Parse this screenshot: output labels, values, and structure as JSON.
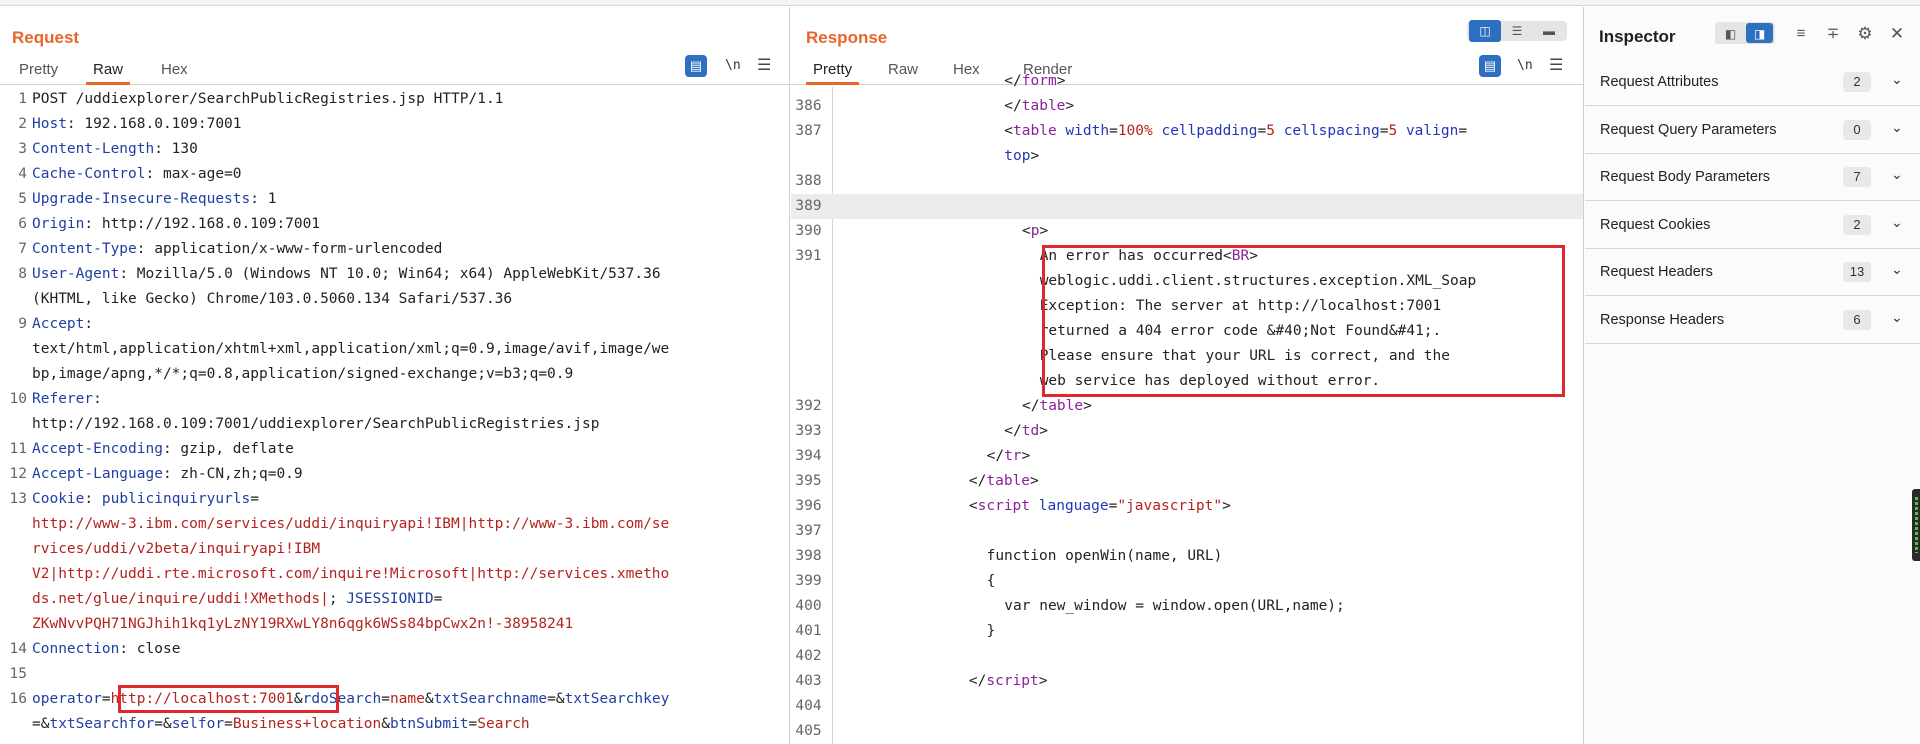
{
  "request": {
    "title": "Request",
    "tabs": [
      "Pretty",
      "Raw",
      "Hex"
    ],
    "active_tab": "Raw",
    "ln_toggle": "\\n",
    "lines": [
      {
        "n": "1",
        "rows": [
          [
            [
              "pl",
              "POST /uddiexplorer/SearchPublicRegistries.jsp HTTP/1.1"
            ]
          ]
        ]
      },
      {
        "n": "2",
        "rows": [
          [
            [
              "k",
              "Host"
            ],
            [
              "pl",
              ": 192.168.0.109:7001"
            ]
          ]
        ]
      },
      {
        "n": "3",
        "rows": [
          [
            [
              "k",
              "Content-Length"
            ],
            [
              "pl",
              ": 130"
            ]
          ]
        ]
      },
      {
        "n": "4",
        "rows": [
          [
            [
              "k",
              "Cache-Control"
            ],
            [
              "pl",
              ": max-age=0"
            ]
          ]
        ]
      },
      {
        "n": "5",
        "rows": [
          [
            [
              "k",
              "Upgrade-Insecure-Requests"
            ],
            [
              "pl",
              ": 1"
            ]
          ]
        ]
      },
      {
        "n": "6",
        "rows": [
          [
            [
              "k",
              "Origin"
            ],
            [
              "pl",
              ": http://192.168.0.109:7001"
            ]
          ]
        ]
      },
      {
        "n": "7",
        "rows": [
          [
            [
              "k",
              "Content-Type"
            ],
            [
              "pl",
              ": application/x-www-form-urlencoded"
            ]
          ]
        ]
      },
      {
        "n": "8",
        "rows": [
          [
            [
              "k",
              "User-Agent"
            ],
            [
              "pl",
              ": Mozilla/5.0 (Windows NT 10.0; Win64; x64) AppleWebKit/537.36"
            ]
          ],
          [
            [
              "pl",
              "(KHTML, like Gecko) Chrome/103.0.5060.134 Safari/537.36"
            ]
          ]
        ]
      },
      {
        "n": "9",
        "rows": [
          [
            [
              "k",
              "Accept"
            ],
            [
              "pl",
              ":"
            ]
          ],
          [
            [
              "pl",
              "text/html,application/xhtml+xml,application/xml;q=0.9,image/avif,image/we"
            ]
          ],
          [
            [
              "pl",
              "bp,image/apng,*/*;q=0.8,application/signed-exchange;v=b3;q=0.9"
            ]
          ]
        ]
      },
      {
        "n": "10",
        "rows": [
          [
            [
              "k",
              "Referer"
            ],
            [
              "pl",
              ":"
            ]
          ],
          [
            [
              "pl",
              "http://192.168.0.109:7001/uddiexplorer/SearchPublicRegistries.jsp"
            ]
          ]
        ]
      },
      {
        "n": "11",
        "rows": [
          [
            [
              "k",
              "Accept-Encoding"
            ],
            [
              "pl",
              ": gzip, deflate"
            ]
          ]
        ]
      },
      {
        "n": "12",
        "rows": [
          [
            [
              "k",
              "Accept-Language"
            ],
            [
              "pl",
              ": zh-CN,zh;q=0.9"
            ]
          ]
        ]
      },
      {
        "n": "13",
        "rows": [
          [
            [
              "k",
              "Cookie"
            ],
            [
              "pl",
              ": "
            ],
            [
              "k",
              "publicinquiryurls"
            ],
            [
              "pl",
              "="
            ]
          ],
          [
            [
              "v",
              "http://www-3.ibm.com/services/uddi/inquiryapi!IBM|http://www-3.ibm.com/se"
            ]
          ],
          [
            [
              "v",
              "rvices/uddi/v2beta/inquiryapi!IBM"
            ]
          ],
          [
            [
              "v",
              "V2|http://uddi.rte.microsoft.com/inquire!Microsoft|http://services.xmetho"
            ]
          ],
          [
            [
              "v",
              "ds.net/glue/inquire/uddi!XMethods|"
            ],
            [
              "pl",
              "; "
            ],
            [
              "k",
              "JSESSIONID"
            ],
            [
              "pl",
              "="
            ]
          ],
          [
            [
              "v",
              "ZKwNvvPQH71NGJhih1kq1yLzNY19RXwLY8n6qgk6WSs84bpCwx2n!-38958241"
            ]
          ]
        ]
      },
      {
        "n": "14",
        "rows": [
          [
            [
              "k",
              "Connection"
            ],
            [
              "pl",
              ": close"
            ]
          ]
        ]
      },
      {
        "n": "15",
        "rows": [
          [
            [
              "pl",
              ""
            ]
          ]
        ]
      },
      {
        "n": "16",
        "rows": [
          [
            [
              "k",
              "operator"
            ],
            [
              "pl",
              "="
            ],
            [
              "v",
              "http://localhost:7001"
            ],
            [
              "pl",
              "&"
            ],
            [
              "k",
              "rdoSearch"
            ],
            [
              "pl",
              "="
            ],
            [
              "v",
              "name"
            ],
            [
              "pl",
              "&"
            ],
            [
              "k",
              "txtSearchname"
            ],
            [
              "pl",
              "=&"
            ],
            [
              "k",
              "txtSearchkey"
            ]
          ],
          [
            [
              "pl",
              "=&"
            ],
            [
              "k",
              "txtSearchfor"
            ],
            [
              "pl",
              "=&"
            ],
            [
              "k",
              "selfor"
            ],
            [
              "pl",
              "="
            ],
            [
              "v",
              "Business+location"
            ],
            [
              "pl",
              "&"
            ],
            [
              "k",
              "btnSubmit"
            ],
            [
              "pl",
              "="
            ],
            [
              "v",
              "Search"
            ]
          ]
        ]
      }
    ]
  },
  "response": {
    "title": "Response",
    "tabs": [
      "Pretty",
      "Raw",
      "Hex",
      "Render"
    ],
    "active_tab": "Pretty",
    "ln_toggle": "\\n",
    "lines": [
      {
        "n": "",
        "indent": 18,
        "rows": [
          [
            [
              "pl",
              "</"
            ],
            [
              "t",
              "form"
            ],
            [
              "pl",
              ">"
            ]
          ]
        ]
      },
      {
        "n": "386",
        "indent": 18,
        "rows": [
          [
            [
              "pl",
              "</"
            ],
            [
              "t",
              "table"
            ],
            [
              "pl",
              ">"
            ]
          ]
        ]
      },
      {
        "n": "387",
        "indent": 18,
        "rows": [
          [
            [
              "pl",
              "<"
            ],
            [
              "t",
              "table"
            ],
            [
              "pl",
              " "
            ],
            [
              "a",
              "width"
            ],
            [
              "pl",
              "="
            ],
            [
              "v",
              "100%"
            ],
            [
              "pl",
              " "
            ],
            [
              "a",
              "cellpadding"
            ],
            [
              "pl",
              "="
            ],
            [
              "v",
              "5"
            ],
            [
              "pl",
              " "
            ],
            [
              "a",
              "cellspacing"
            ],
            [
              "pl",
              "="
            ],
            [
              "v",
              "5"
            ],
            [
              "pl",
              " "
            ],
            [
              "a",
              "valign"
            ],
            [
              "pl",
              "="
            ]
          ],
          [
            [
              "a",
              "top"
            ],
            [
              "pl",
              ">"
            ]
          ]
        ]
      },
      {
        "n": "388",
        "indent": 0,
        "rows": [
          [
            [
              "pl",
              ""
            ]
          ]
        ]
      },
      {
        "n": "389",
        "indent": 0,
        "hl": true,
        "rows": [
          [
            [
              "pl",
              ""
            ]
          ]
        ]
      },
      {
        "n": "390",
        "indent": 20,
        "rows": [
          [
            [
              "pl",
              "<"
            ],
            [
              "t",
              "p"
            ],
            [
              "pl",
              ">"
            ]
          ]
        ]
      },
      {
        "n": "391",
        "indent": 22,
        "rows": [
          [
            [
              "pl",
              "An error has occurred<"
            ],
            [
              "t",
              "BR"
            ],
            [
              "pl",
              ">"
            ]
          ],
          [
            [
              "pl",
              "weblogic.uddi.client.structures.exception.XML_Soap"
            ]
          ],
          [
            [
              "pl",
              "Exception: The server at http://localhost:7001"
            ]
          ],
          [
            [
              "pl",
              "returned a 404 error code &#40;Not Found&#41;."
            ]
          ],
          [
            [
              "pl",
              "Please ensure that your URL is correct, and the"
            ]
          ],
          [
            [
              "pl",
              "web service has deployed without error."
            ]
          ]
        ]
      },
      {
        "n": "392",
        "indent": 20,
        "rows": [
          [
            [
              "pl",
              "</"
            ],
            [
              "t",
              "table"
            ],
            [
              "pl",
              ">"
            ]
          ]
        ]
      },
      {
        "n": "393",
        "indent": 18,
        "rows": [
          [
            [
              "pl",
              "</"
            ],
            [
              "t",
              "td"
            ],
            [
              "pl",
              ">"
            ]
          ]
        ]
      },
      {
        "n": "394",
        "indent": 16,
        "rows": [
          [
            [
              "pl",
              "</"
            ],
            [
              "t",
              "tr"
            ],
            [
              "pl",
              ">"
            ]
          ]
        ]
      },
      {
        "n": "395",
        "indent": 14,
        "rows": [
          [
            [
              "pl",
              "</"
            ],
            [
              "t",
              "table"
            ],
            [
              "pl",
              ">"
            ]
          ]
        ]
      },
      {
        "n": "396",
        "indent": 14,
        "rows": [
          [
            [
              "pl",
              "<"
            ],
            [
              "t",
              "script"
            ],
            [
              "pl",
              " "
            ],
            [
              "a",
              "language"
            ],
            [
              "pl",
              "="
            ],
            [
              "v",
              "\"javascript\""
            ],
            [
              "pl",
              ">"
            ]
          ]
        ]
      },
      {
        "n": "397",
        "indent": 0,
        "rows": [
          [
            [
              "pl",
              ""
            ]
          ]
        ]
      },
      {
        "n": "398",
        "indent": 16,
        "rows": [
          [
            [
              "pl",
              "function openWin(name, URL)"
            ]
          ]
        ]
      },
      {
        "n": "399",
        "indent": 16,
        "rows": [
          [
            [
              "pl",
              "{"
            ]
          ]
        ]
      },
      {
        "n": "400",
        "indent": 18,
        "rows": [
          [
            [
              "pl",
              "var new_window = window.open(URL,name);"
            ]
          ]
        ]
      },
      {
        "n": "401",
        "indent": 16,
        "rows": [
          [
            [
              "pl",
              "}"
            ]
          ]
        ]
      },
      {
        "n": "402",
        "indent": 0,
        "rows": [
          [
            [
              "pl",
              ""
            ]
          ]
        ]
      },
      {
        "n": "403",
        "indent": 14,
        "rows": [
          [
            [
              "pl",
              "</"
            ],
            [
              "t",
              "script"
            ],
            [
              "pl",
              ">"
            ]
          ]
        ]
      },
      {
        "n": "404",
        "indent": 0,
        "rows": [
          [
            [
              "pl",
              ""
            ]
          ]
        ]
      },
      {
        "n": "405",
        "indent": 0,
        "rows": [
          [
            [
              "pl",
              ""
            ]
          ]
        ]
      }
    ]
  },
  "inspector": {
    "title": "Inspector",
    "sections": [
      {
        "label": "Request Attributes",
        "count": "2"
      },
      {
        "label": "Request Query Parameters",
        "count": "0"
      },
      {
        "label": "Request Body Parameters",
        "count": "7"
      },
      {
        "label": "Request Cookies",
        "count": "2"
      },
      {
        "label": "Request Headers",
        "count": "13"
      },
      {
        "label": "Response Headers",
        "count": "6"
      }
    ]
  },
  "colors": {
    "accent": "#e8652b",
    "header_key": "#1f3fa3",
    "value": "#b4231f",
    "tag": "#8a2399",
    "highlight_box": "#e0272b",
    "toggle_active": "#2f6fc0"
  }
}
